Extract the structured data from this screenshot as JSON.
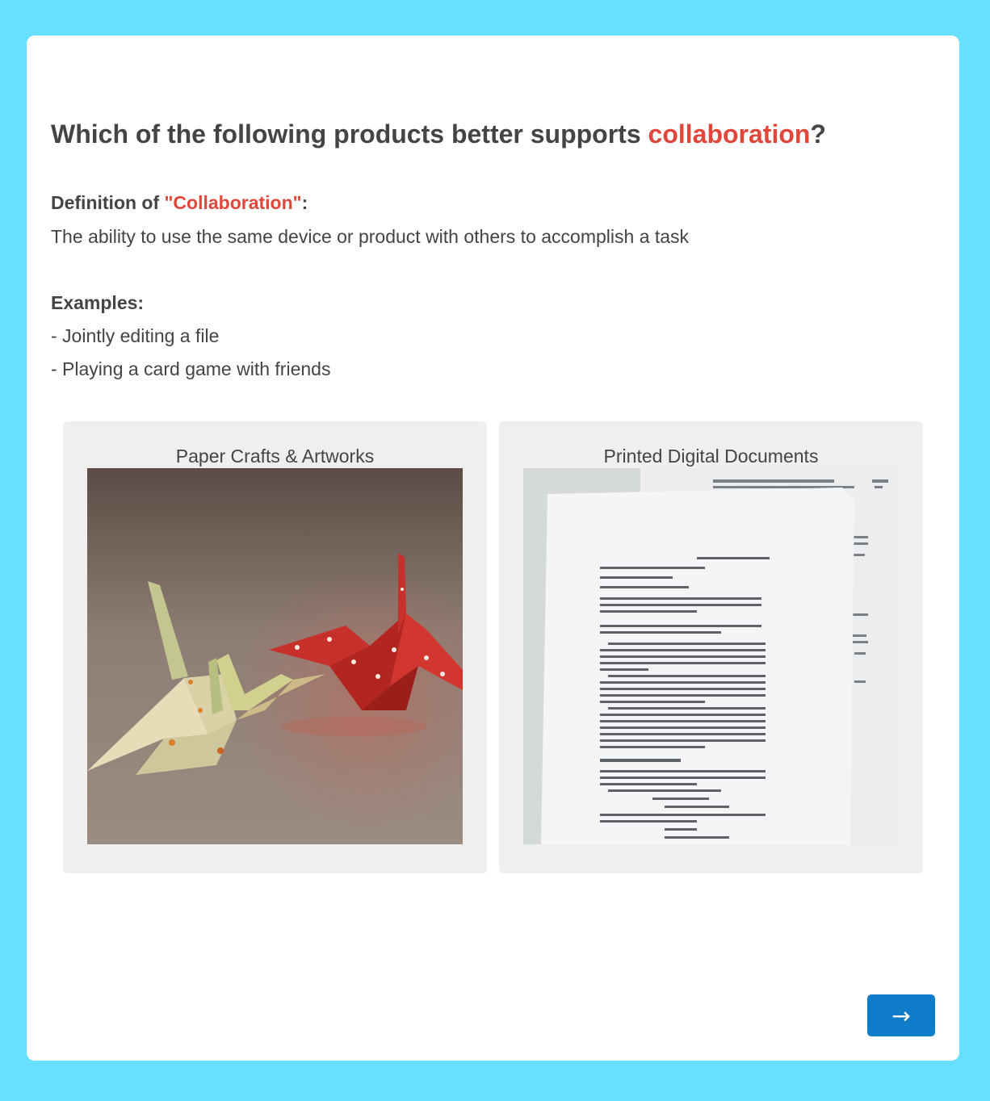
{
  "question": {
    "prefix": "Which of the following products better supports ",
    "highlight": "collaboration",
    "suffix": "?"
  },
  "definition": {
    "heading_prefix": "Definition of ",
    "heading_term": "\"Collaboration\"",
    "heading_suffix": ":",
    "text": "The ability to use the same device or product with others to accomplish a task"
  },
  "examples": {
    "heading": "Examples:",
    "items": [
      "- Jointly editing a file",
      "- Playing a card game with friends"
    ]
  },
  "options": [
    {
      "label": "Paper Crafts & Artworks",
      "image": "origami-cranes-photo"
    },
    {
      "label": "Printed Digital Documents",
      "image": "printed-document-photo"
    }
  ],
  "next_button": {
    "label": "→",
    "icon": "arrow-right-icon"
  },
  "colors": {
    "background": "#67DFFE",
    "card": "#FFFFFF",
    "accent": "#E0463A",
    "text": "#444444",
    "option_bg": "#EFEFEF",
    "button": "#0F7CC9"
  }
}
